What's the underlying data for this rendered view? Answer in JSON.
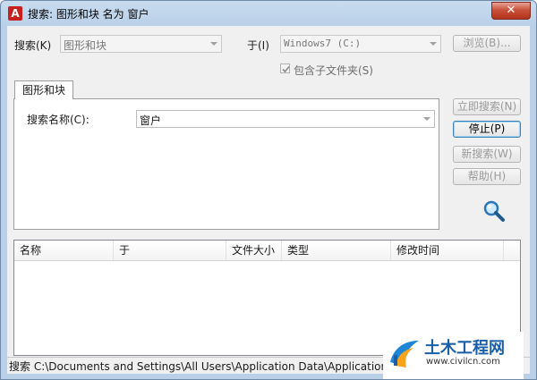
{
  "window": {
    "title": "搜索: 图形和块 名为 窗户",
    "close_glyph": "✕"
  },
  "search_in": {
    "label": "搜索(K)",
    "value": "图形和块"
  },
  "location": {
    "label": "于(I)",
    "value": "Windows7 (C:)"
  },
  "browse_button": "浏览(B)...",
  "include_subfolders": {
    "label": "包含子文件夹(S)",
    "checked": true
  },
  "tab": {
    "label": "图形和块"
  },
  "name_field": {
    "label": "搜索名称(C):",
    "value": "窗户"
  },
  "buttons": {
    "search_now": "立即搜索(N)",
    "stop": "停止(P)",
    "new_search": "新搜索(W)",
    "help": "帮助(H)"
  },
  "results": {
    "columns": [
      "名称",
      "于",
      "文件大小",
      "类型",
      "修改时间"
    ]
  },
  "status": {
    "text": "搜索 C:\\Documents and Settings\\All Users\\Application Data\\Application"
  },
  "watermark": {
    "name": "土木工程网",
    "url": "www.civilcn.com"
  },
  "colors": {
    "title_bg": "#b9d0e8",
    "client_bg": "#f0f0f0",
    "accent": "#3c7fb1",
    "close": "#c9513b"
  }
}
